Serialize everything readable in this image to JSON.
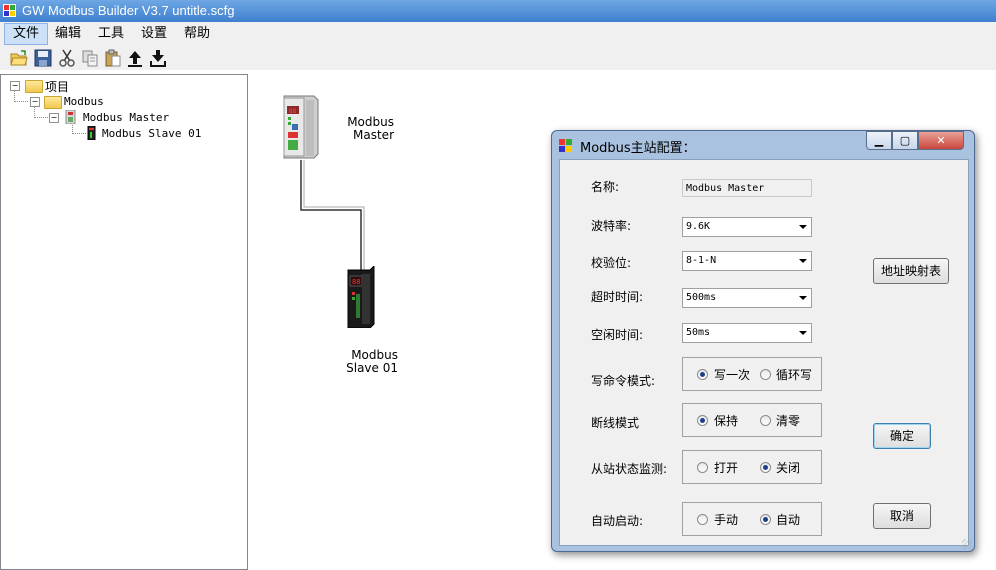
{
  "window": {
    "title": "GW Modbus Builder V3.7   untitle.scfg"
  },
  "menu": {
    "items": [
      "文件",
      "编辑",
      "工具",
      "设置",
      "帮助"
    ]
  },
  "toolbar": {
    "icons": [
      "open-folder-icon",
      "save-icon",
      "cut-icon",
      "copy-icon",
      "paste-icon",
      "upload-icon",
      "download-icon"
    ]
  },
  "tree": {
    "root": "项目",
    "modbus": "Modbus",
    "master": "Modbus Master",
    "slave": "Modbus Slave  01"
  },
  "canvas": {
    "master_label_line1": "Modbus",
    "master_label_line2": "Master",
    "slave_label_line1": "Modbus",
    "slave_label_line2": "Slave  01"
  },
  "dialog": {
    "title": "Modbus主站配置：",
    "name_label": "名称:",
    "name_value": "Modbus Master",
    "baud_label": "波特率:",
    "baud_value": "9.6K",
    "parity_label": "校验位:",
    "parity_value": "8-1-N",
    "timeout_label": "超时时间:",
    "timeout_value": "500ms",
    "idle_label": "空闲时间:",
    "idle_value": "50ms",
    "write_mode_label": "写命令模式:",
    "write_mode_options": [
      "写一次",
      "循环写"
    ],
    "write_mode_selected": 0,
    "disconnect_label": "断线模式",
    "disconnect_options": [
      "保持",
      "清零"
    ],
    "disconnect_selected": 0,
    "slave_monitor_label": "从站状态监测:",
    "slave_monitor_options": [
      "打开",
      "关闭"
    ],
    "slave_monitor_selected": 1,
    "autostart_label": "自动启动:",
    "autostart_options": [
      "手动",
      "自动"
    ],
    "autostart_selected": 1,
    "address_map_button": "地址映射表",
    "ok_button": "确定",
    "cancel_button": "取消"
  },
  "colors": {
    "titlebar": "#3f7fcf",
    "dialog_frame": "#a9c2e0",
    "close_button": "#c9463d"
  }
}
